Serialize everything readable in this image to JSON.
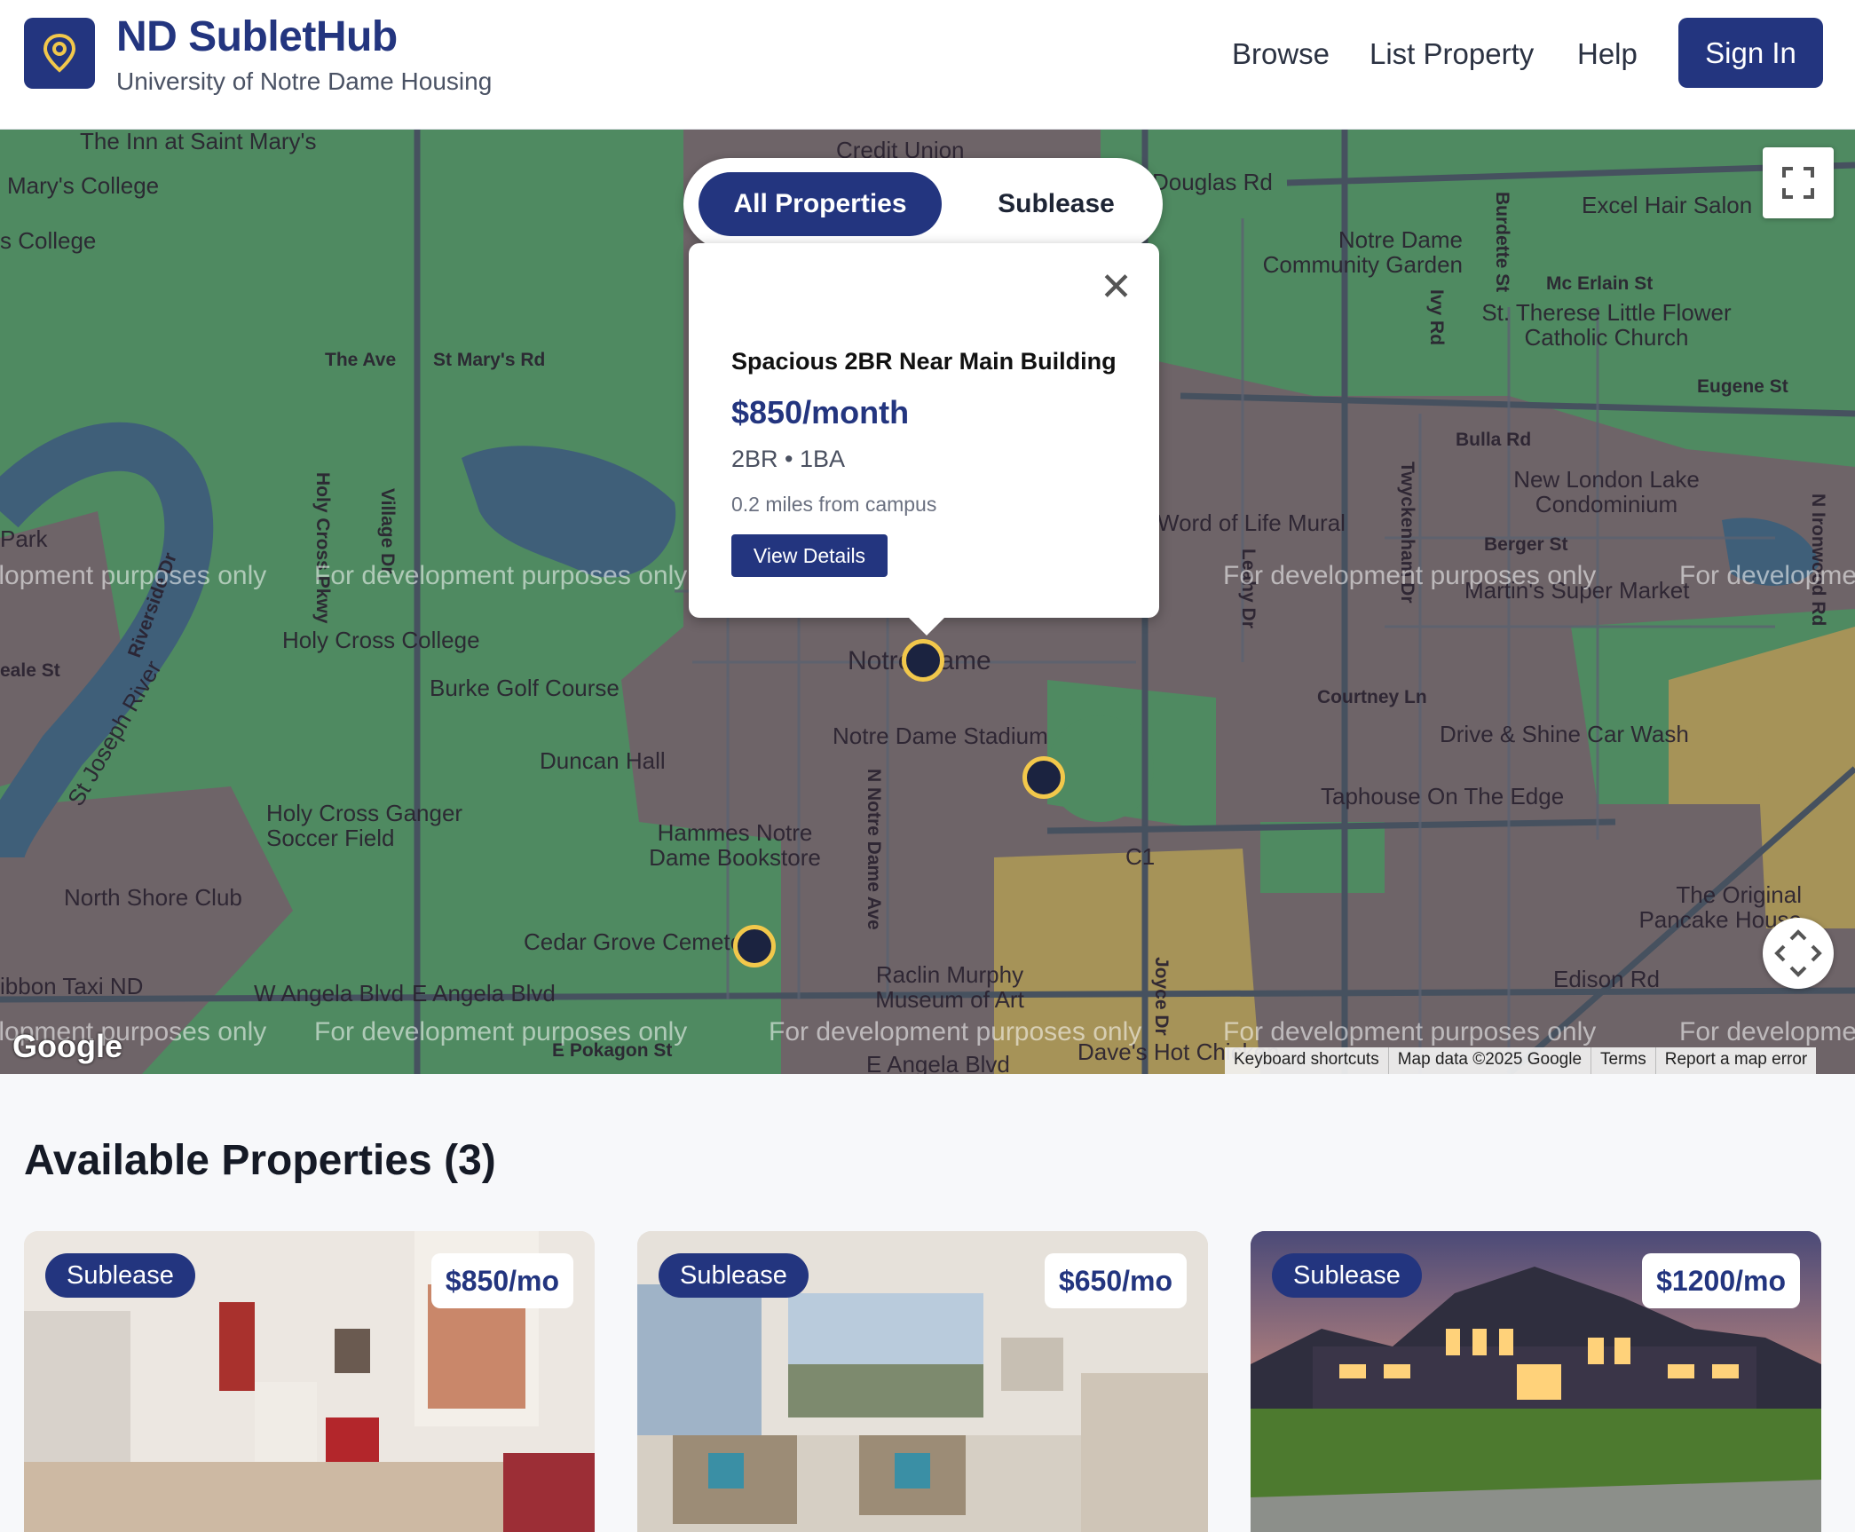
{
  "header": {
    "title": "ND SubletHub",
    "subtitle": "University of Notre Dame Housing",
    "nav": [
      "Browse",
      "List Property",
      "Help"
    ],
    "sign_in": "Sign In"
  },
  "map": {
    "toggle": {
      "active": "All Properties",
      "inactive": "Sublease"
    },
    "popup": {
      "title": "Spacious 2BR Near Main Building",
      "price": "$850/month",
      "beds": "2BR • 1BA",
      "distance": "0.2 miles from campus",
      "button": "View Details"
    },
    "watermark": "For development purposes only",
    "google": "Google",
    "attribution": [
      "Keyboard shortcuts",
      "Map data ©2025 Google",
      "Terms",
      "Report a map error"
    ],
    "labels": {
      "inn": "The Inn at Saint Mary's",
      "marys_college": "Mary's College",
      "s_college": "s College",
      "credit_union": "Credit Union",
      "douglas": "Douglas Rd",
      "excel": "Excel Hair Salon",
      "community_garden": "Notre Dame Community Garden",
      "burdette": "Burdette St",
      "mc_erlain": "Mc Erlain St",
      "st_therese": "St. Therese Little Flower Catholic Church",
      "eugene": "Eugene St",
      "ivy": "Ivy Rd",
      "the_ave": "The Ave",
      "st_marys_rd": "St Mary's Rd",
      "bulla": "Bulla Rd",
      "new_london": "New London Lake Condominium",
      "word_of_life": "Word of Life Mural",
      "berger": "Berger St",
      "super_market": "Martin's Super Market",
      "park": "Park",
      "holy_cross_college": "Holy Cross College",
      "burke": "Burke Golf Course",
      "notre_dame": "Notre Dame",
      "stadium": "Notre Dame Stadium",
      "courtney": "Courtney Ln",
      "drive_shine": "Drive & Shine Car Wash",
      "duncan": "Duncan Hall",
      "taphouse": "Taphouse On The Edge",
      "holy_cross_ganger": "Holy Cross Ganger Soccer Field",
      "hammes": "Hammes Notre Dame Bookstore",
      "c1": "C1",
      "north_shore": "North Shore Club",
      "original_pancake": "The Original Pancake House",
      "cedar_grove": "Cedar Grove Cemetery",
      "raclin": "Raclin Murphy Museum of Art",
      "edison": "Edison Rd",
      "taxi": "ibbon Taxi ND",
      "w_angela": "W Angela Blvd",
      "e_angela": "E Angela Blvd",
      "e_angela2": "E Angela Blvd",
      "e_pokagon": "E Pokagon St",
      "daves": "Dave's Hot Chicken",
      "eale": "eale St",
      "riverside": "Riverside Dr",
      "st_joseph": "St Joseph River",
      "n_notre_dame": "N Notre Dame Ave",
      "twyckenham": "Twyckenham Dr",
      "leahy": "Leahy Dr",
      "joyce": "Joyce Dr",
      "n_ironwood": "N Ironwood Rd",
      "holy_cross_pkwy": "Holy Cross Pkwy",
      "village": "Village Dr"
    }
  },
  "listings": {
    "title": "Available Properties (3)",
    "cards": [
      {
        "badge": "Sublease",
        "price": "$850/mo"
      },
      {
        "badge": "Sublease",
        "price": "$650/mo"
      },
      {
        "badge": "Sublease",
        "price": "$1200/mo"
      }
    ]
  },
  "colors": {
    "brand": "#23357f",
    "marker_ring": "#f2c84b",
    "map_green": "#4f8a61",
    "map_urban": "#6e6468"
  }
}
